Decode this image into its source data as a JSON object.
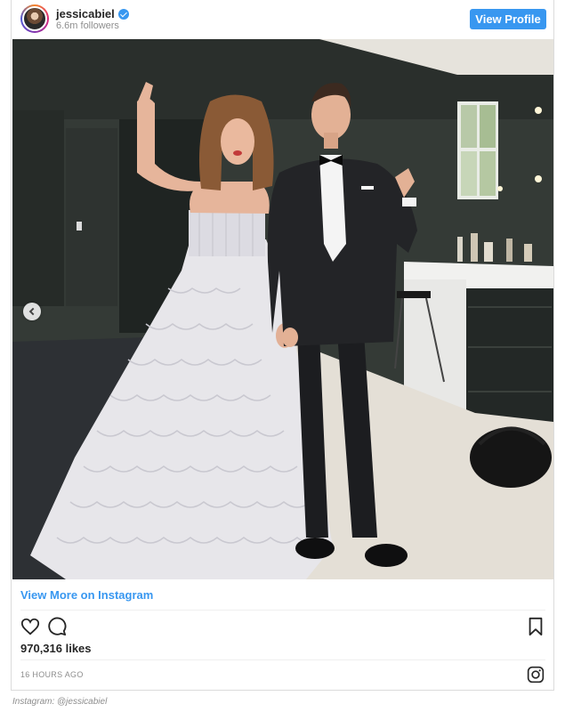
{
  "header": {
    "username": "jessicabiel",
    "followers": "6.6m followers",
    "view_profile_label": "View Profile",
    "verified_color": "#3897f0"
  },
  "photo": {
    "description_icon": "photo",
    "carousel_prev_icon": "chevron-left-icon"
  },
  "footer": {
    "view_more_label": "View More on Instagram",
    "likes": "970,316 likes",
    "timestamp": "16 HOURS AGO",
    "icons": [
      "heart-icon",
      "comment-icon",
      "bookmark-icon",
      "instagram-logo-icon"
    ]
  },
  "caption": "Instagram: @jessicabiel",
  "colors": {
    "accent": "#3897f0",
    "muted": "#8e8e8e",
    "text": "#262626"
  }
}
